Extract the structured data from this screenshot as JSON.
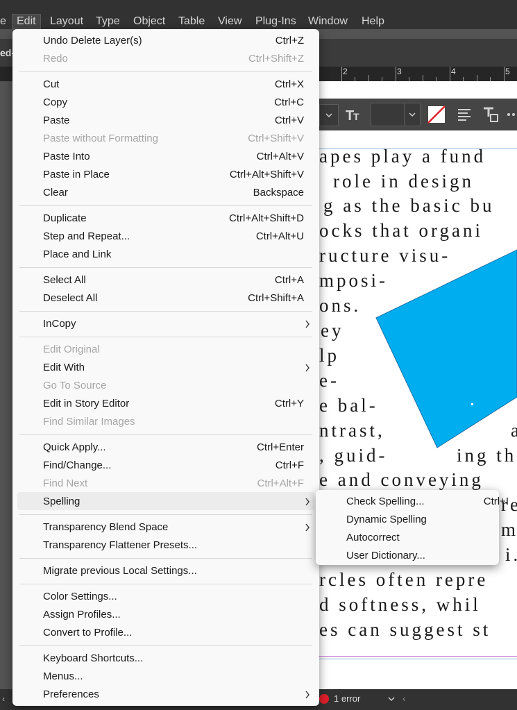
{
  "menubar": {
    "items": [
      "e",
      "Edit",
      "Layout",
      "Type",
      "Object",
      "Table",
      "View",
      "Plug-Ins",
      "Window",
      "Help"
    ]
  },
  "doc_tab": "ed-",
  "ruler": {
    "labels": [
      "2",
      "3",
      "4",
      "5"
    ]
  },
  "control_bar": {
    "font_size_value": ""
  },
  "page_text": {
    "lines": [
      "apes play a fund",
      "role in design",
      "g as the basic bu",
      "ocks that organi",
      "ructure visu-",
      "mposi-",
      "ons.",
      "ey",
      "lp",
      "e-",
      "e bal-",
      "ntrast,",
      "a",
      ", guid-",
      "ing th",
      "e and conveying",
      "re",
      "m",
      "i.",
      "rcles often repre",
      "d softness, whil",
      "es can suggest st"
    ]
  },
  "shape": {
    "color": "#00aeef"
  },
  "status": {
    "error_text": "1 error"
  },
  "edit_menu": {
    "groups": [
      [
        {
          "label": "Undo Delete Layer(s)",
          "shortcut": "Ctrl+Z"
        },
        {
          "label": "Redo",
          "shortcut": "Ctrl+Shift+Z",
          "disabled": true
        }
      ],
      [
        {
          "label": "Cut",
          "shortcut": "Ctrl+X"
        },
        {
          "label": "Copy",
          "shortcut": "Ctrl+C"
        },
        {
          "label": "Paste",
          "shortcut": "Ctrl+V"
        },
        {
          "label": "Paste without Formatting",
          "shortcut": "Ctrl+Shift+V",
          "disabled": true
        },
        {
          "label": "Paste Into",
          "shortcut": "Ctrl+Alt+V"
        },
        {
          "label": "Paste in Place",
          "shortcut": "Ctrl+Alt+Shift+V"
        },
        {
          "label": "Clear",
          "shortcut": "Backspace"
        }
      ],
      [
        {
          "label": "Duplicate",
          "shortcut": "Ctrl+Alt+Shift+D"
        },
        {
          "label": "Step and Repeat...",
          "shortcut": "Ctrl+Alt+U"
        },
        {
          "label": "Place and Link",
          "shortcut": ""
        }
      ],
      [
        {
          "label": "Select All",
          "shortcut": "Ctrl+A"
        },
        {
          "label": "Deselect All",
          "shortcut": "Ctrl+Shift+A"
        }
      ],
      [
        {
          "label": "InCopy",
          "shortcut": "",
          "submenu": true
        }
      ],
      [
        {
          "label": "Edit Original",
          "shortcut": "",
          "disabled": true
        },
        {
          "label": "Edit With",
          "shortcut": "",
          "submenu": true
        },
        {
          "label": "Go To Source",
          "shortcut": "",
          "disabled": true
        },
        {
          "label": "Edit in Story Editor",
          "shortcut": "Ctrl+Y"
        },
        {
          "label": "Find Similar Images",
          "shortcut": "",
          "disabled": true
        }
      ],
      [
        {
          "label": "Quick Apply...",
          "shortcut": "Ctrl+Enter"
        },
        {
          "label": "Find/Change...",
          "shortcut": "Ctrl+F"
        },
        {
          "label": "Find Next",
          "shortcut": "Ctrl+Alt+F",
          "disabled": true
        },
        {
          "label": "Spelling",
          "shortcut": "",
          "submenu": true,
          "highlighted": true
        }
      ],
      [
        {
          "label": "Transparency Blend Space",
          "shortcut": "",
          "submenu": true
        },
        {
          "label": "Transparency Flattener Presets...",
          "shortcut": ""
        }
      ],
      [
        {
          "label": "Migrate previous Local Settings...",
          "shortcut": ""
        }
      ],
      [
        {
          "label": "Color Settings...",
          "shortcut": ""
        },
        {
          "label": "Assign Profiles...",
          "shortcut": ""
        },
        {
          "label": "Convert to Profile...",
          "shortcut": ""
        }
      ],
      [
        {
          "label": "Keyboard Shortcuts...",
          "shortcut": ""
        },
        {
          "label": "Menus...",
          "shortcut": ""
        },
        {
          "label": "Preferences",
          "shortcut": "",
          "submenu": true
        }
      ]
    ]
  },
  "spelling_submenu": {
    "items": [
      {
        "label": "Check Spelling...",
        "shortcut": "Ctrl+I"
      },
      {
        "label": "Dynamic Spelling",
        "shortcut": ""
      },
      {
        "label": "Autocorrect",
        "shortcut": ""
      },
      {
        "label": "User Dictionary...",
        "shortcut": ""
      }
    ]
  }
}
